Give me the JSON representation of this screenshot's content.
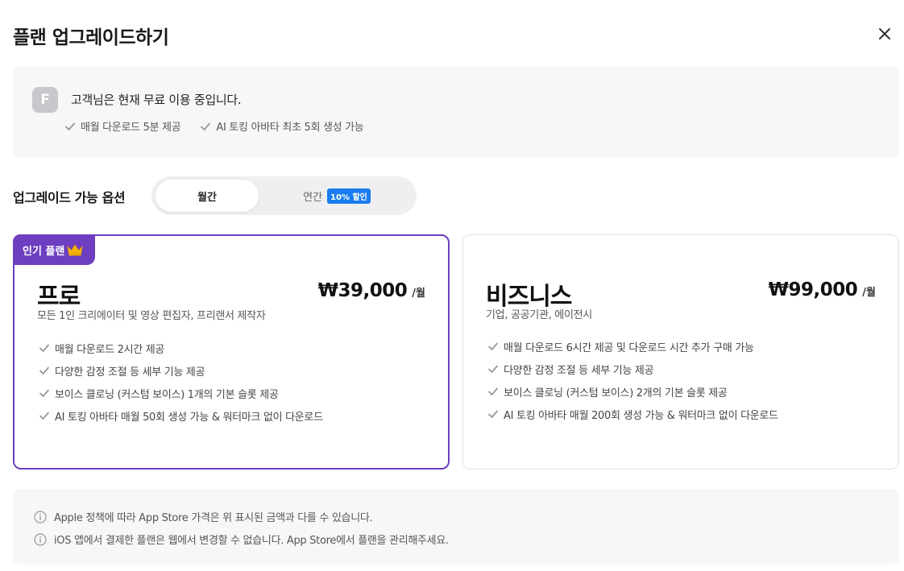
{
  "title": "플랜 업그레이드하기",
  "status": {
    "avatar_letter": "F",
    "text": "고객님은 현재 무료 이용 중입니다.",
    "features": [
      "매월 다운로드 5분 제공",
      "AI 토킹 아바타 최초 5회 생성 가능"
    ]
  },
  "options": {
    "label": "업그레이드 가능 옵션",
    "monthly": "월간",
    "yearly": "연간",
    "yearly_badge": "10% 할인",
    "selected": "monthly"
  },
  "plans": [
    {
      "badge": "인기 플랜",
      "name": "프로",
      "price": "₩39,000",
      "unit": "/월",
      "desc": "모든 1인 크리에이터 및 영상 편집자, 프리랜서 제작자",
      "features": [
        "매월 다운로드 2시간 제공",
        "다양한 감정 조절 등 세부 기능 제공",
        "보이스 클로닝 (커스텀 보이스) 1개의 기본 슬롯 제공",
        "AI 토킹 아바타 매월 50회 생성 가능 & 워터마크 없이 다운로드"
      ]
    },
    {
      "name": "비즈니스",
      "price": "₩99,000",
      "unit": "/월",
      "desc": "기업, 공공기관, 에이전시",
      "features": [
        "매월 다운로드 6시간 제공 및 다운로드 시간 추가 구매 가능",
        "다양한 감정 조절 등 세부 기능 제공",
        "보이스 클로닝 (커스텀 보이스) 2개의 기본 슬롯 제공",
        "AI 토킹 아바타 매월 200회 생성 가능 & 워터마크 없이 다운로드"
      ]
    }
  ],
  "notices": [
    "Apple 정책에 따라 App Store 가격은 위 표시된 금액과 다를 수 있습니다.",
    "iOS 앱에서 결제한 플랜은 웹에서 변경할 수 없습니다. App Store에서 플랜을 관리해주세요."
  ],
  "colors": {
    "accent_purple": "#6d3fc0",
    "badge_blue": "#1a7cf0",
    "panel_bg": "#f7f7f8"
  }
}
